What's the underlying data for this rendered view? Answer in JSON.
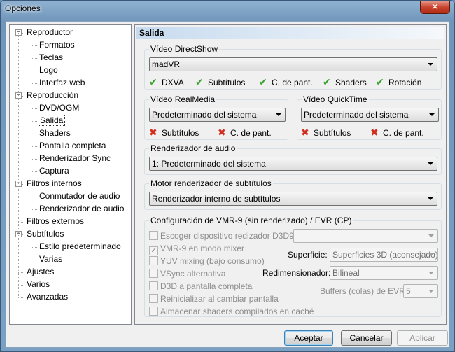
{
  "window": {
    "title": "Opciones",
    "close_glyph": "✕"
  },
  "tree": [
    {
      "label": "Reproductor",
      "level": 0,
      "expander": "−"
    },
    {
      "label": "Formatos",
      "level": 1
    },
    {
      "label": "Teclas",
      "level": 1
    },
    {
      "label": "Logo",
      "level": 1
    },
    {
      "label": "Interfaz web",
      "level": 1
    },
    {
      "label": "Reproducción",
      "level": 0,
      "expander": "−"
    },
    {
      "label": "DVD/OGM",
      "level": 1
    },
    {
      "label": "Salida",
      "level": 1,
      "selected": true
    },
    {
      "label": "Shaders",
      "level": 1
    },
    {
      "label": "Pantalla completa",
      "level": 1
    },
    {
      "label": "Renderizador Sync",
      "level": 1
    },
    {
      "label": "Captura",
      "level": 1
    },
    {
      "label": "Filtros internos",
      "level": 0,
      "expander": "−"
    },
    {
      "label": "Conmutador de audio",
      "level": 1
    },
    {
      "label": "Renderizador de audio",
      "level": 1
    },
    {
      "label": "Filtros externos",
      "level": 0
    },
    {
      "label": "Subtítulos",
      "level": 0,
      "expander": "−"
    },
    {
      "label": "Estilo predeterminado",
      "level": 1
    },
    {
      "label": "Varias",
      "level": 1
    },
    {
      "label": "Ajustes",
      "level": 0
    },
    {
      "label": "Varios",
      "level": 0
    },
    {
      "label": "Avanzadas",
      "level": 0
    }
  ],
  "page": {
    "header": "Salida",
    "directshow": {
      "title": "Vídeo DirectShow",
      "value": "madVR",
      "caps": [
        "DXVA",
        "Subtítulos",
        "C. de pant.",
        "Shaders",
        "Rotación"
      ]
    },
    "realmedia": {
      "title": "Vídeo RealMedia",
      "value": "Predeterminado del sistema",
      "caps": [
        "Subtítulos",
        "C. de pant."
      ]
    },
    "quicktime": {
      "title": "Vídeo QuickTime",
      "value": "Predeterminado del sistema",
      "caps": [
        "Subtítulos",
        "C. de pant."
      ]
    },
    "audio": {
      "title": "Renderizador de audio",
      "value": "1: Predeterminado del sistema"
    },
    "subtitles": {
      "title": "Motor renderizador de subtítulos",
      "value": "Renderizador interno de subtítulos"
    },
    "vmr": {
      "title": "Configuración de VMR-9 (sin renderizado) / EVR (CP)",
      "checkboxes": [
        {
          "label": "Escoger dispositivo redizador D3D9",
          "checked": false
        },
        {
          "label": "VMR-9 en modo mixer",
          "checked": true
        },
        {
          "label": "YUV mixing (bajo consumo)",
          "checked": false
        },
        {
          "label": "VSync alternativa",
          "checked": false
        },
        {
          "label": "D3D a pantalla completa",
          "checked": false
        },
        {
          "label": "Reinicializar al cambiar pantalla",
          "checked": false
        },
        {
          "label": "Almacenar shaders compilados en caché",
          "checked": false
        }
      ],
      "device_value": "",
      "surface_label": "Superficie:",
      "surface_value": "Superficies 3D (aconsejado)",
      "resizer_label": "Redimensionador:",
      "resizer_value": "Bilineal",
      "buffers_label": "Buffers (colas) de EVR:",
      "buffers_value": "5"
    }
  },
  "buttons": {
    "ok": "Aceptar",
    "cancel": "Cancelar",
    "apply": "Aplicar"
  },
  "icons": {
    "check": "✔",
    "cross": "✖",
    "check_color": "#38a02c",
    "cross_color": "#d22e1e"
  }
}
